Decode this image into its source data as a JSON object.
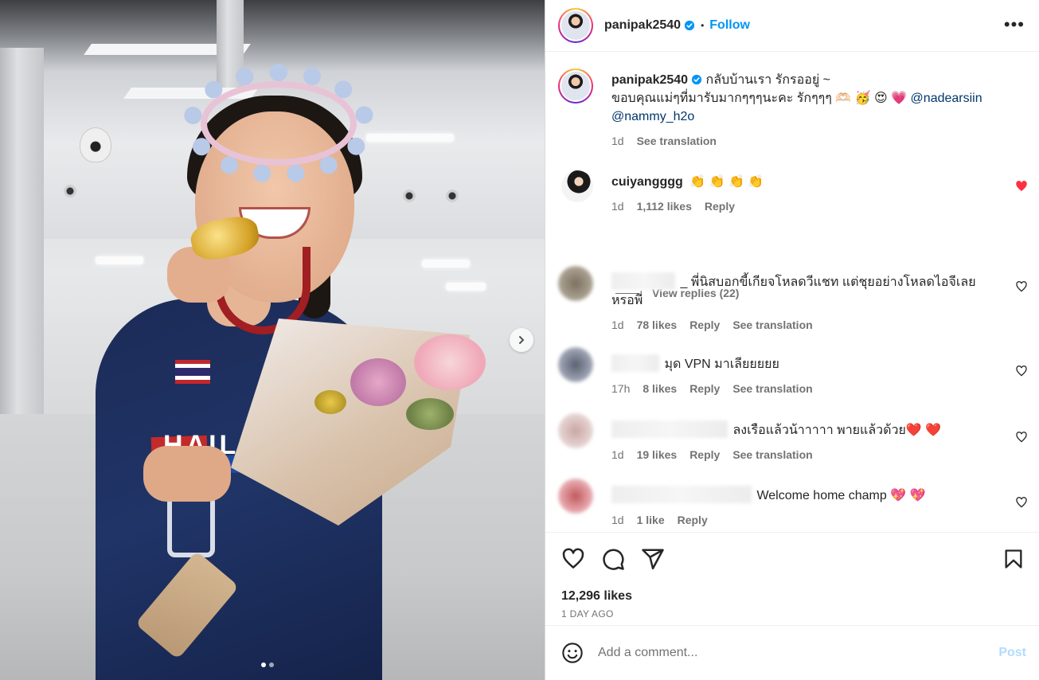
{
  "post": {
    "username": "panipak2540",
    "follow_label": "Follow",
    "bullet": "•",
    "more_label": "•••"
  },
  "caption": {
    "username": "panipak2540",
    "text_line1": "กลับบ้านเรา รักรออยู่ ~",
    "text_line2": "ขอบคุณแม่ๆที่มารับมากๆๆๆนะคะ รักๆๆๆ 🫶🏻 🥳 😍 💗",
    "mention1": "@nadearsiin",
    "mention2": "@nammy_h2o",
    "time": "1d",
    "see_translation": "See translation"
  },
  "comments": [
    {
      "username": "cuiyangggg",
      "text": "👏 👏 👏 👏",
      "time": "1d",
      "likes": "1,112 likes",
      "reply": "Reply",
      "liked": true
    },
    {
      "username": "",
      "text": "_ พี่นิสบอกขี้เกียจโหลดวีแชท แต่ชุยอย่างโหลดไอจีเลยหรอพี่",
      "time": "1d",
      "likes": "78 likes",
      "reply": "Reply",
      "see_translation": "See translation"
    },
    {
      "username": "",
      "text": "มุด VPN มาเลียยยยย",
      "time": "17h",
      "likes": "8 likes",
      "reply": "Reply",
      "see_translation": "See translation"
    },
    {
      "username": "",
      "text": "ลงเรือแล้วน้าาาาา พายแล้วด้วย❤️ ❤️",
      "time": "1d",
      "likes": "19 likes",
      "reply": "Reply",
      "see_translation": "See translation"
    },
    {
      "username": "",
      "text": "Welcome home champ 💖 💖",
      "time": "1d",
      "likes": "1 like",
      "reply": "Reply"
    }
  ],
  "view_replies": "View replies (22)",
  "actions": {
    "likes": "12,296 likes",
    "posted": "1 DAY AGO"
  },
  "add_comment": {
    "placeholder": "Add a comment...",
    "post_label": "Post"
  },
  "photo_text": {
    "jersey": "HAIL"
  },
  "icons": [
    "heart-icon",
    "comment-icon",
    "share-icon",
    "bookmark-icon",
    "smiley-icon",
    "verified-icon",
    "chevron-right-icon",
    "more-icon"
  ],
  "colors": {
    "accent": "#0095f6",
    "like_red": "#ff3040",
    "mention": "#00376b",
    "post_disabled": "#b3dbff"
  }
}
